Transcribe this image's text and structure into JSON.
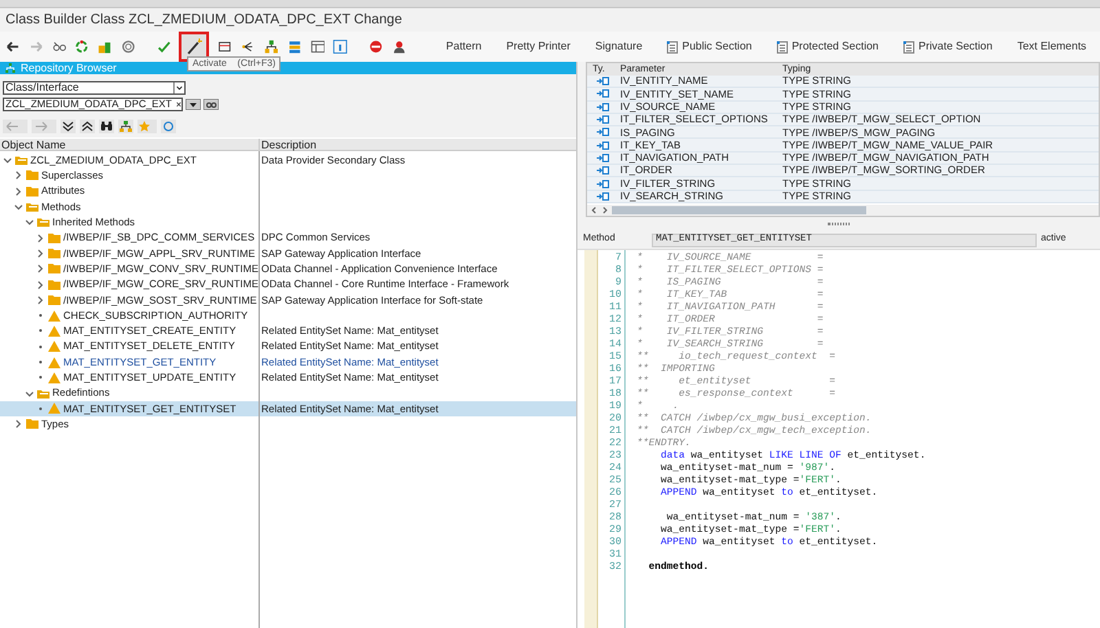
{
  "window": {
    "title": "Class Builder Class ZCL_ZMEDIUM_ODATA_DPC_EXT Change"
  },
  "toolbar": {
    "buttons": [
      {
        "label": "Pattern"
      },
      {
        "label": "Pretty Printer"
      },
      {
        "label": "Signature"
      },
      {
        "label": "Public Section",
        "kind": "section"
      },
      {
        "label": "Protected Section",
        "kind": "section"
      },
      {
        "label": "Private Section",
        "kind": "section"
      },
      {
        "label": "Text Elements"
      }
    ],
    "tooltip": {
      "label": "Activate",
      "shortcut": "(Ctrl+F3)"
    }
  },
  "repository_browser": {
    "title": "Repository Browser",
    "object_type": "Class/Interface",
    "object_name": "ZCL_ZMEDIUM_ODATA_DPC_EXT",
    "columns": [
      "Object Name",
      "Description"
    ],
    "tree": [
      {
        "label": "ZCL_ZMEDIUM_ODATA_DPC_EXT",
        "description": "Data Provider Secondary Class",
        "kind": "folder",
        "expanded": true,
        "selected": false,
        "children": [
          {
            "label": "Superclasses",
            "kind": "folder",
            "expanded": false,
            "selected": false
          },
          {
            "label": "Attributes",
            "kind": "folder",
            "expanded": false,
            "selected": false
          },
          {
            "label": "Methods",
            "kind": "folder",
            "expanded": true,
            "selected": false,
            "children": [
              {
                "label": "Inherited Methods",
                "kind": "folder",
                "expanded": true,
                "selected": false,
                "children": [
                  {
                    "label": "/IWBEP/IF_SB_DPC_COMM_SERVICES",
                    "description": "DPC Common Services",
                    "kind": "folder",
                    "expanded": false,
                    "selected": false
                  },
                  {
                    "label": "/IWBEP/IF_MGW_APPL_SRV_RUNTIME",
                    "description": "SAP Gateway Application Interface",
                    "kind": "folder",
                    "expanded": false,
                    "selected": false
                  },
                  {
                    "label": "/IWBEP/IF_MGW_CONV_SRV_RUNTIME",
                    "description": "OData Channel - Application Convenience Interface",
                    "kind": "folder",
                    "expanded": false,
                    "selected": false
                  },
                  {
                    "label": "/IWBEP/IF_MGW_CORE_SRV_RUNTIME",
                    "description": "OData Channel - Core Runtime Interface - Framework",
                    "kind": "folder",
                    "expanded": false,
                    "selected": false
                  },
                  {
                    "label": "/IWBEP/IF_MGW_SOST_SRV_RUNTIME",
                    "description": "SAP Gateway Application Interface for Soft-state",
                    "kind": "folder",
                    "expanded": false,
                    "selected": false
                  },
                  {
                    "label": "CHECK_SUBSCRIPTION_AUTHORITY",
                    "kind": "method",
                    "highlighted": false,
                    "selected": false
                  },
                  {
                    "label": "MAT_ENTITYSET_CREATE_ENTITY",
                    "description": "Related EntitySet Name: Mat_entityset",
                    "kind": "method",
                    "highlighted": false,
                    "selected": false
                  },
                  {
                    "label": "MAT_ENTITYSET_DELETE_ENTITY",
                    "description": "Related EntitySet Name: Mat_entityset",
                    "kind": "method",
                    "highlighted": false,
                    "selected": false
                  },
                  {
                    "label": "MAT_ENTITYSET_GET_ENTITY",
                    "description": "Related EntitySet Name: Mat_entityset",
                    "kind": "method",
                    "highlighted": true,
                    "selected": false
                  },
                  {
                    "label": "MAT_ENTITYSET_UPDATE_ENTITY",
                    "description": "Related EntitySet Name: Mat_entityset",
                    "kind": "method",
                    "highlighted": false,
                    "selected": false
                  }
                ]
              },
              {
                "label": "Redefintions",
                "kind": "folder",
                "expanded": true,
                "selected": false,
                "children": [
                  {
                    "label": "MAT_ENTITYSET_GET_ENTITYSET",
                    "description": "Related EntitySet Name: Mat_entityset",
                    "kind": "method",
                    "highlighted": false,
                    "selected": true
                  }
                ]
              }
            ]
          },
          {
            "label": "Types",
            "kind": "folder",
            "expanded": false,
            "selected": false
          }
        ]
      }
    ]
  },
  "parameters": {
    "columns": [
      "Ty.",
      "Parameter",
      "Typing"
    ],
    "rows": [
      {
        "parameter": "IV_ENTITY_NAME",
        "typing": "TYPE STRING"
      },
      {
        "parameter": "IV_ENTITY_SET_NAME",
        "typing": "TYPE STRING"
      },
      {
        "parameter": "IV_SOURCE_NAME",
        "typing": "TYPE STRING"
      },
      {
        "parameter": "IT_FILTER_SELECT_OPTIONS",
        "typing": "TYPE /IWBEP/T_MGW_SELECT_OPTION"
      },
      {
        "parameter": "IS_PAGING",
        "typing": "TYPE /IWBEP/S_MGW_PAGING"
      },
      {
        "parameter": "IT_KEY_TAB",
        "typing": "TYPE /IWBEP/T_MGW_NAME_VALUE_PAIR"
      },
      {
        "parameter": "IT_NAVIGATION_PATH",
        "typing": "TYPE /IWBEP/T_MGW_NAVIGATION_PATH"
      },
      {
        "parameter": "IT_ORDER",
        "typing": "TYPE /IWBEP/T_MGW_SORTING_ORDER"
      },
      {
        "parameter": "IV_FILTER_STRING",
        "typing": "TYPE STRING"
      },
      {
        "parameter": "IV_SEARCH_STRING",
        "typing": "TYPE STRING"
      }
    ]
  },
  "method_bar": {
    "label": "Method",
    "name": "MAT_ENTITYSET_GET_ENTITYSET",
    "status": "active"
  },
  "editor": {
    "lines": [
      {
        "number": "7",
        "segments": [
          {
            "kind": "comment",
            "text": "*    IV_SOURCE_NAME           ="
          }
        ]
      },
      {
        "number": "8",
        "segments": [
          {
            "kind": "comment",
            "text": "*    IT_FILTER_SELECT_OPTIONS ="
          }
        ]
      },
      {
        "number": "9",
        "segments": [
          {
            "kind": "comment",
            "text": "*    IS_PAGING                ="
          }
        ]
      },
      {
        "number": "10",
        "segments": [
          {
            "kind": "comment",
            "text": "*    IT_KEY_TAB               ="
          }
        ]
      },
      {
        "number": "11",
        "segments": [
          {
            "kind": "comment",
            "text": "*    IT_NAVIGATION_PATH       ="
          }
        ]
      },
      {
        "number": "12",
        "segments": [
          {
            "kind": "comment",
            "text": "*    IT_ORDER                 ="
          }
        ]
      },
      {
        "number": "13",
        "segments": [
          {
            "kind": "comment",
            "text": "*    IV_FILTER_STRING         ="
          }
        ]
      },
      {
        "number": "14",
        "segments": [
          {
            "kind": "comment",
            "text": "*    IV_SEARCH_STRING         ="
          }
        ]
      },
      {
        "number": "15",
        "segments": [
          {
            "kind": "comment",
            "text": "**     io_tech_request_context  ="
          }
        ]
      },
      {
        "number": "16",
        "segments": [
          {
            "kind": "comment",
            "text": "**  IMPORTING"
          }
        ]
      },
      {
        "number": "17",
        "segments": [
          {
            "kind": "comment",
            "text": "**     et_entityset             ="
          }
        ]
      },
      {
        "number": "18",
        "segments": [
          {
            "kind": "comment",
            "text": "**     es_response_context      ="
          }
        ]
      },
      {
        "number": "19",
        "segments": [
          {
            "kind": "comment",
            "text": "*     ."
          }
        ]
      },
      {
        "number": "20",
        "segments": [
          {
            "kind": "comment",
            "text": "**  CATCH /iwbep/cx_mgw_busi_exception."
          }
        ]
      },
      {
        "number": "21",
        "segments": [
          {
            "kind": "comment",
            "text": "**  CATCH /iwbep/cx_mgw_tech_exception."
          }
        ]
      },
      {
        "number": "22",
        "segments": [
          {
            "kind": "comment",
            "text": "**ENDTRY."
          }
        ]
      },
      {
        "number": "23",
        "segments": [
          {
            "kind": "keyword",
            "text": "    data"
          },
          {
            "kind": "plain",
            "text": " wa_entityset "
          },
          {
            "kind": "keyword",
            "text": "LIKE LINE OF"
          },
          {
            "kind": "plain",
            "text": " et_entityset."
          }
        ]
      },
      {
        "number": "24",
        "segments": [
          {
            "kind": "plain",
            "text": "    wa_entityset-mat_num = "
          },
          {
            "kind": "literal",
            "text": "'987'"
          },
          {
            "kind": "plain",
            "text": "."
          }
        ]
      },
      {
        "number": "25",
        "segments": [
          {
            "kind": "plain",
            "text": "    wa_entityset-mat_type ="
          },
          {
            "kind": "literal",
            "text": "'FERT'"
          },
          {
            "kind": "plain",
            "text": "."
          }
        ]
      },
      {
        "number": "26",
        "segments": [
          {
            "kind": "keyword",
            "text": "    APPEND"
          },
          {
            "kind": "plain",
            "text": " wa_entityset "
          },
          {
            "kind": "keyword",
            "text": "to"
          },
          {
            "kind": "plain",
            "text": " et_entityset."
          }
        ]
      },
      {
        "number": "27"
      },
      {
        "number": "28",
        "segments": [
          {
            "kind": "plain",
            "text": "     wa_entityset-mat_num = "
          },
          {
            "kind": "literal",
            "text": "'387'"
          },
          {
            "kind": "plain",
            "text": "."
          }
        ]
      },
      {
        "number": "29",
        "segments": [
          {
            "kind": "plain",
            "text": "    wa_entityset-mat_type ="
          },
          {
            "kind": "literal",
            "text": "'FERT'"
          },
          {
            "kind": "plain",
            "text": "."
          }
        ]
      },
      {
        "number": "30",
        "segments": [
          {
            "kind": "keyword",
            "text": "    APPEND"
          },
          {
            "kind": "plain",
            "text": " wa_entityset "
          },
          {
            "kind": "keyword",
            "text": "to"
          },
          {
            "kind": "plain",
            "text": " et_entityset."
          }
        ]
      },
      {
        "number": "31"
      },
      {
        "number": "32",
        "segments": [
          {
            "kind": "statement",
            "text": "  endmethod."
          }
        ]
      }
    ]
  }
}
